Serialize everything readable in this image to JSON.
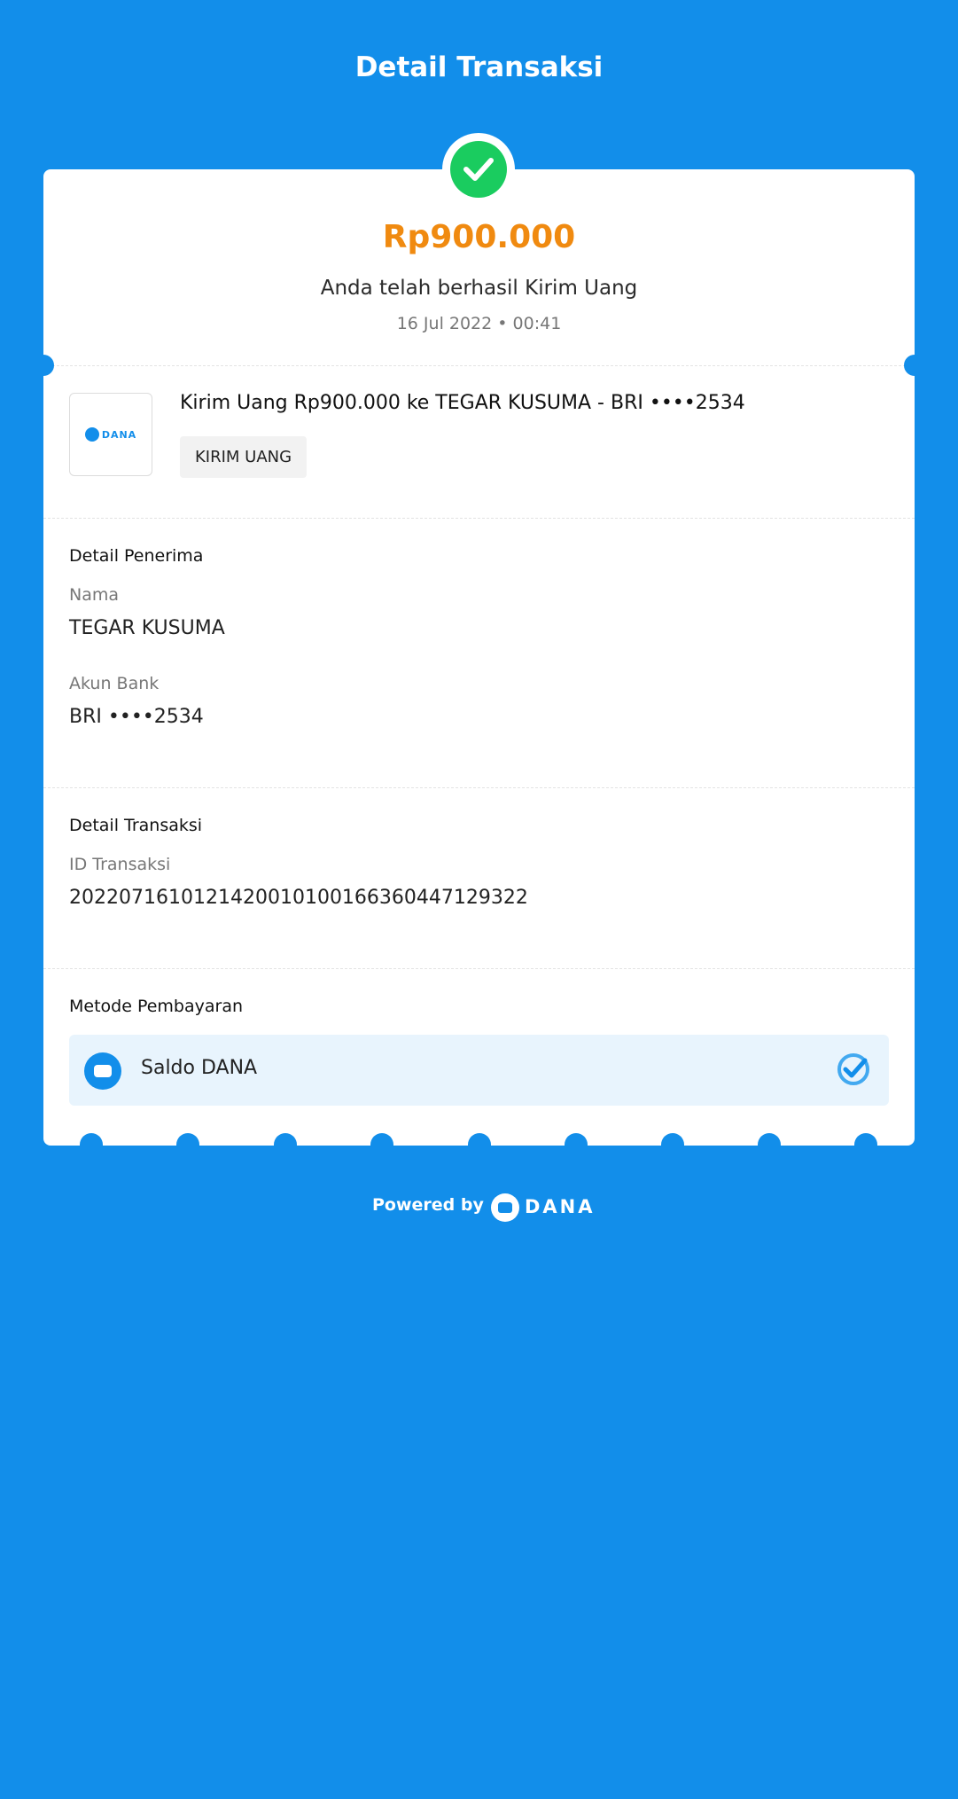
{
  "header": {
    "title": "Detail Transaksi"
  },
  "summary": {
    "amount": "Rp900.000",
    "message": "Anda telah berhasil Kirim Uang",
    "datetime": "16 Jul 2022 • 00:41"
  },
  "transaction": {
    "logo_text": "DANA",
    "title": "Kirim Uang Rp900.000 ke TEGAR KUSUMA - BRI ••••2534",
    "tag": "KIRIM UANG"
  },
  "recipient": {
    "section_title": "Detail Penerima",
    "name_label": "Nama",
    "name_value": "TEGAR KUSUMA",
    "bank_label": "Akun Bank",
    "bank_value": "BRI ••••2534"
  },
  "details": {
    "section_title": "Detail Transaksi",
    "id_label": "ID Transaksi",
    "id_value": "2022071610121420010100166360447129322"
  },
  "payment": {
    "section_title": "Metode Pembayaran",
    "method_label": "Saldo DANA",
    "method_selected": true
  },
  "footer": {
    "powered_label": "Powered by",
    "brand": "DANA"
  },
  "colors": {
    "background": "#128EEA",
    "amount": "#F08A10",
    "success": "#1ACC5F"
  },
  "icons": [
    "check-icon",
    "dana-logo-icon",
    "wallet-icon",
    "check-circle-icon"
  ]
}
